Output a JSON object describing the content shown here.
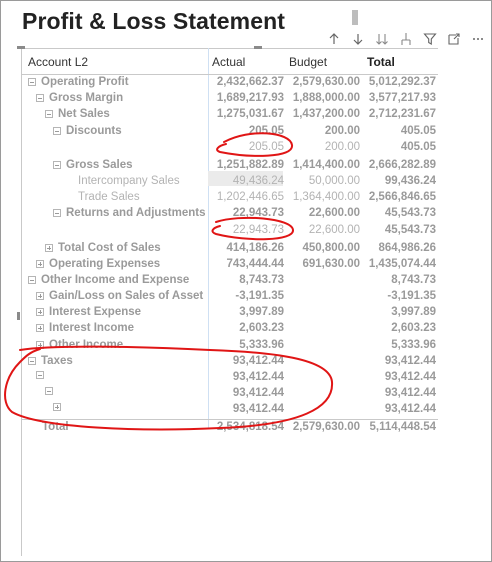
{
  "title": "Profit & Loss Statement",
  "toolbar": {
    "icons": [
      "arrow-up-icon",
      "arrow-down-icon",
      "double-arrow-down-icon",
      "expand-hierarchy-icon",
      "filter-icon",
      "focus-mode-icon",
      "more-options-icon"
    ]
  },
  "table": {
    "headers": {
      "account": "Account L2",
      "actual": "Actual",
      "budget": "Budget",
      "total": "Total"
    },
    "rows": [
      {
        "label": "Operating Profit",
        "actual": "2,432,662.37",
        "budget": "2,579,630.00",
        "total": "5,012,292.37"
      },
      {
        "label": "Gross Margin",
        "actual": "1,689,217.93",
        "budget": "1,888,000.00",
        "total": "3,577,217.93"
      },
      {
        "label": "Net Sales",
        "actual": "1,275,031.67",
        "budget": "1,437,200.00",
        "total": "2,712,231.67"
      },
      {
        "label": "Discounts",
        "actual": "205.05",
        "budget": "200.00",
        "total": "405.05"
      },
      {
        "label": "",
        "actual": "205.05",
        "budget": "200.00",
        "total": "405.05"
      },
      {
        "label": "Gross Sales",
        "actual": "1,251,882.89",
        "budget": "1,414,400.00",
        "total": "2,666,282.89"
      },
      {
        "label": "Intercompany Sales",
        "actual": "49,436.24",
        "budget": "50,000.00",
        "total": "99,436.24"
      },
      {
        "label": "Trade Sales",
        "actual": "1,202,446.65",
        "budget": "1,364,400.00",
        "total": "2,566,846.65"
      },
      {
        "label": "Returns and Adjustments",
        "actual": "22,943.73",
        "budget": "22,600.00",
        "total": "45,543.73"
      },
      {
        "label": "",
        "actual": "22,943.73",
        "budget": "22,600.00",
        "total": "45,543.73"
      },
      {
        "label": "Total Cost of Sales",
        "actual": "414,186.26",
        "budget": "450,800.00",
        "total": "864,986.26"
      },
      {
        "label": "Operating Expenses",
        "actual": "743,444.44",
        "budget": "691,630.00",
        "total": "1,435,074.44"
      },
      {
        "label": "Other Income and Expense",
        "actual": "8,743.73",
        "budget": "",
        "total": "8,743.73"
      },
      {
        "label": "Gain/Loss on Sales of Asset",
        "actual": "-3,191.35",
        "budget": "",
        "total": "-3,191.35"
      },
      {
        "label": "Interest Expense",
        "actual": "3,997.89",
        "budget": "",
        "total": "3,997.89"
      },
      {
        "label": "Interest Income",
        "actual": "2,603.23",
        "budget": "",
        "total": "2,603.23"
      },
      {
        "label": "Other Income",
        "actual": "5,333.96",
        "budget": "",
        "total": "5,333.96"
      },
      {
        "label": "Taxes",
        "actual": "93,412.44",
        "budget": "",
        "total": "93,412.44"
      },
      {
        "label": "",
        "actual": "93,412.44",
        "budget": "",
        "total": "93,412.44"
      },
      {
        "label": "",
        "actual": "93,412.44",
        "budget": "",
        "total": "93,412.44"
      },
      {
        "label": "",
        "actual": "93,412.44",
        "budget": "",
        "total": "93,412.44"
      },
      {
        "label": "Total",
        "actual": "2,534,818.54",
        "budget": "2,579,630.00",
        "total": "5,114,448.54"
      }
    ]
  }
}
